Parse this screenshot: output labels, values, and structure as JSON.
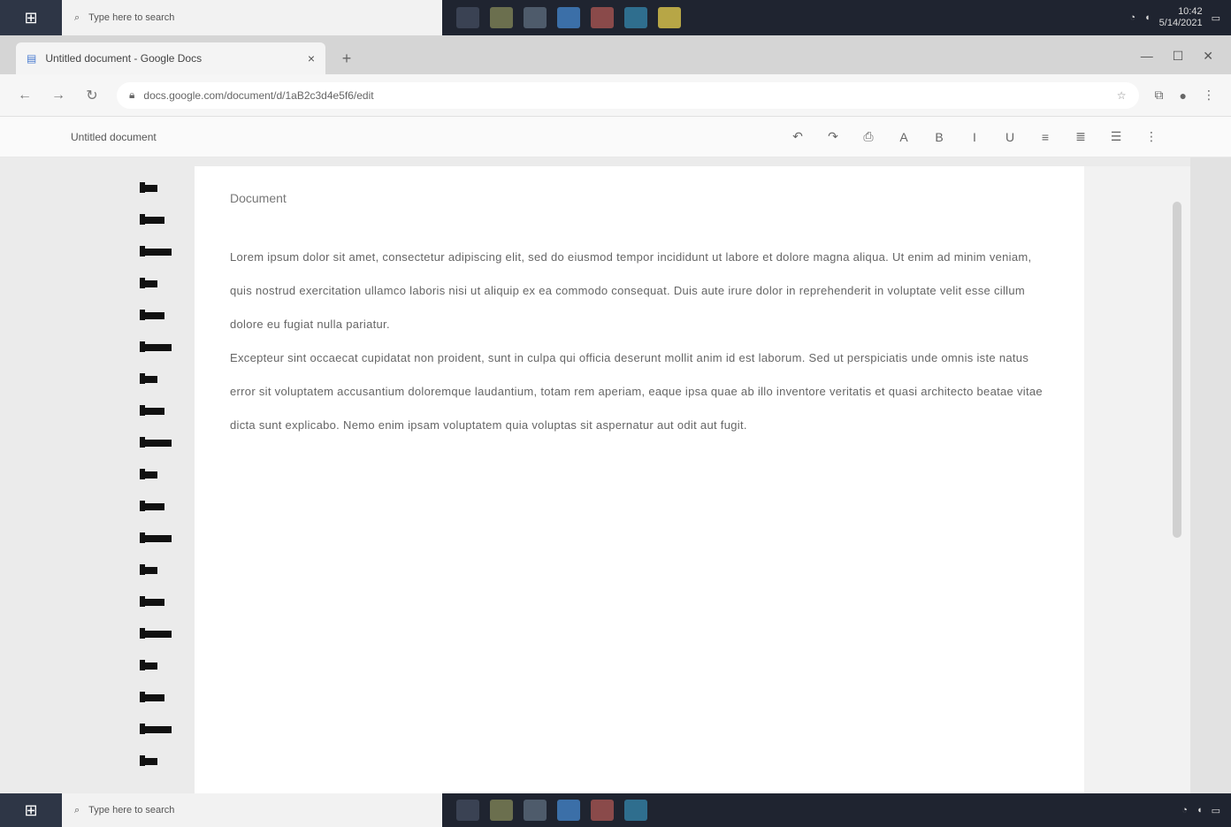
{
  "taskbar_top": {
    "search_placeholder": "Type here to search",
    "clock_time": "10:42",
    "clock_date": "5/14/2021"
  },
  "tab": {
    "title": "Untitled document - Google Docs",
    "close": "×",
    "new_tab": "+"
  },
  "window_controls": {
    "minimize": "—",
    "maximize": "☐",
    "close": "✕"
  },
  "address": {
    "back": "←",
    "forward": "→",
    "reload": "↻",
    "url": "docs.google.com/document/d/1aB2c3d4e5f6/edit",
    "star": "☆"
  },
  "toolbar": {
    "doc_name": "Untitled document",
    "tools": [
      "↶",
      "↷",
      "⎙",
      "A",
      "B",
      "I",
      "U",
      "≡",
      "≣",
      "☰",
      "⋮"
    ]
  },
  "document": {
    "heading": "Document",
    "paragraphs": [
      "Lorem ipsum dolor sit amet, consectetur adipiscing elit, sed do eiusmod tempor incididunt ut labore et dolore magna aliqua. Ut enim ad minim veniam, quis nostrud exercitation ullamco laboris nisi ut aliquip ex ea commodo consequat. Duis aute irure dolor in reprehenderit in voluptate velit esse cillum dolore eu fugiat nulla pariatur.",
      "Excepteur sint occaecat cupidatat non proident, sunt in culpa qui officia deserunt mollit anim id est laborum. Sed ut perspiciatis unde omnis iste natus error sit voluptatem accusantium doloremque laudantium, totam rem aperiam, eaque ipsa quae ab illo inventore veritatis et quasi architecto beatae vitae dicta sunt explicabo. Nemo enim ipsam voluptatem quia voluptas sit aspernatur aut odit aut fugit."
    ]
  },
  "colors": {
    "taskbar": "#1f2430",
    "page": "#ffffff",
    "workspace": "#ebebeb",
    "gutter_mark": "#111111"
  },
  "taskbar_bottom": {
    "search_placeholder": "Type here to search"
  }
}
